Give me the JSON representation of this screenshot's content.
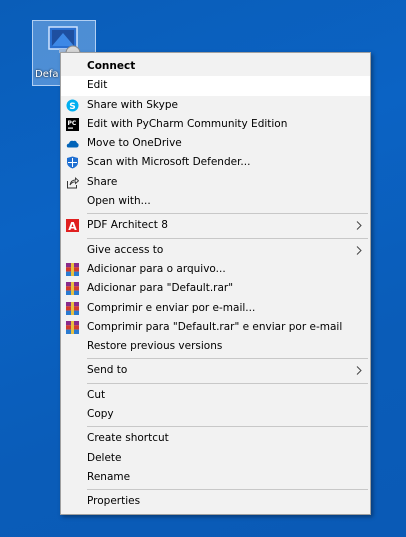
{
  "desktop": {
    "icon_label": "Defa"
  },
  "menu": {
    "connect": "Connect",
    "edit": "Edit",
    "share_skype": "Share with Skype",
    "edit_pycharm": "Edit with PyCharm Community Edition",
    "move_onedrive": "Move to OneDrive",
    "scan_defender": "Scan with Microsoft Defender...",
    "share": "Share",
    "open_with": "Open with...",
    "pdf_architect": "PDF Architect 8",
    "give_access": "Give access to",
    "add_archive": "Adicionar para o arquivo...",
    "add_default_rar": "Adicionar para \"Default.rar\"",
    "compress_email": "Comprimir e enviar por e-mail...",
    "compress_default_email": "Comprimir para \"Default.rar\" e enviar por e-mail",
    "restore_versions": "Restore previous versions",
    "send_to": "Send to",
    "cut": "Cut",
    "copy": "Copy",
    "create_shortcut": "Create shortcut",
    "delete": "Delete",
    "rename": "Rename",
    "properties": "Properties"
  },
  "colors": {
    "desktop_bg": "#0b63c4",
    "menu_bg": "#f2f2f2",
    "skype": "#00aff0",
    "onedrive": "#0364b8",
    "pdf_red": "#e02020"
  }
}
